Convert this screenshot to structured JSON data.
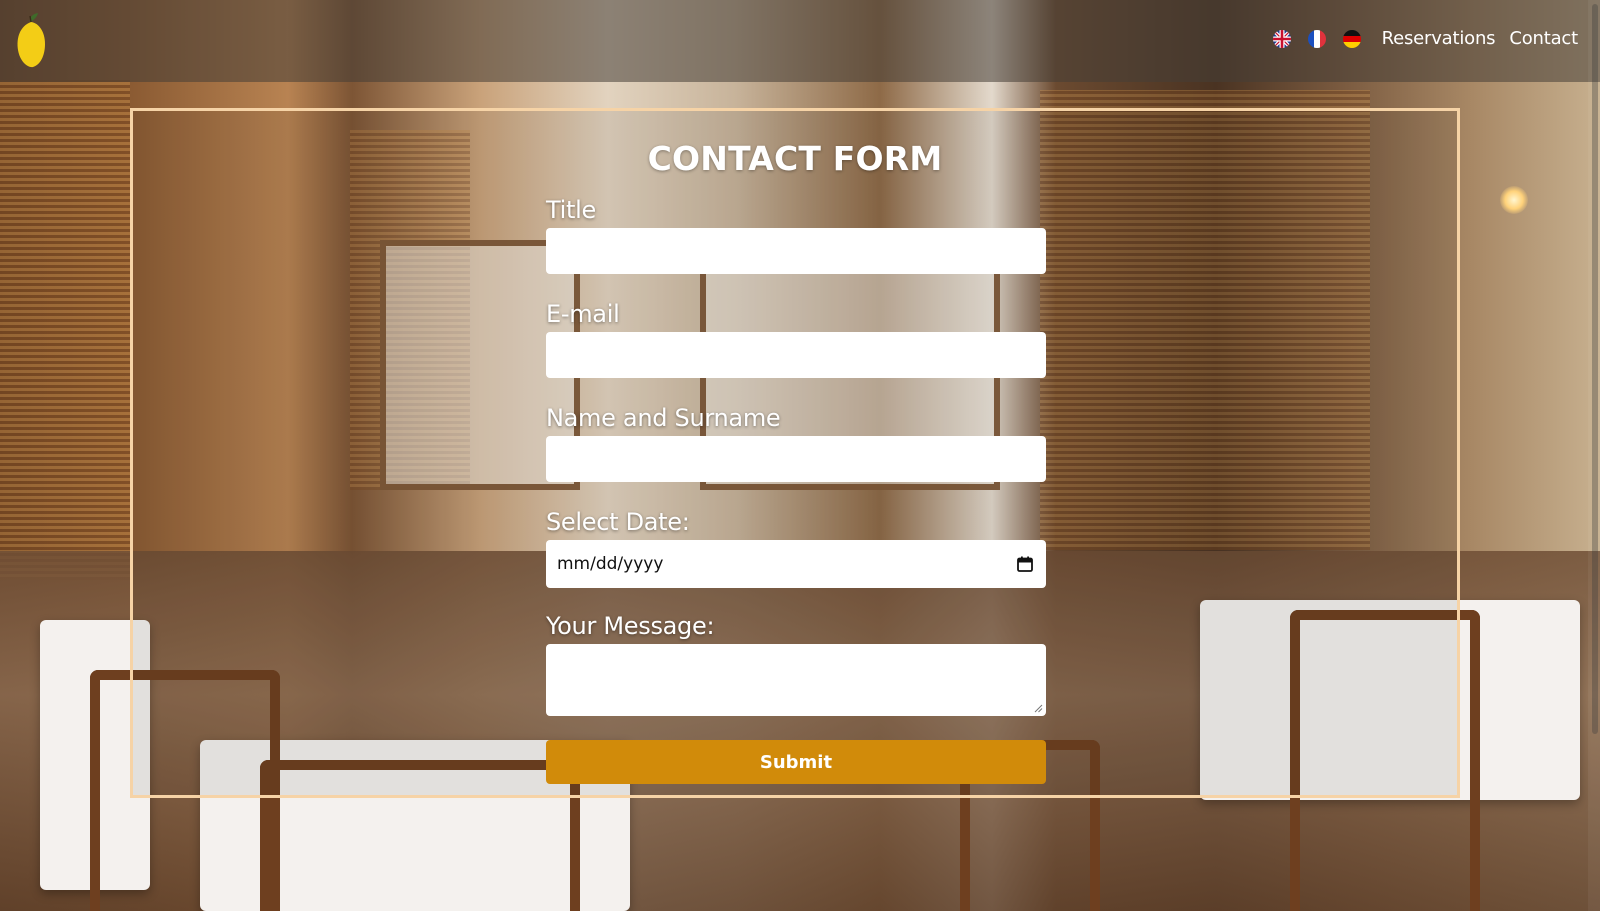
{
  "header": {
    "languages": [
      {
        "code": "en",
        "icon": "uk-flag-icon"
      },
      {
        "code": "fr",
        "icon": "france-flag-icon"
      },
      {
        "code": "de",
        "icon": "germany-flag-icon"
      }
    ],
    "nav_links": [
      "Reservations",
      "Contact"
    ],
    "logo_icon": "lemon-logo-icon"
  },
  "form": {
    "title": "CONTACT FORM",
    "fields": {
      "title_label": "Title",
      "email_label": "E-mail",
      "name_label": "Name and Surname",
      "date_label": "Select Date:",
      "date_placeholder": "mm/dd/yyyy",
      "message_label": "Your Message:"
    },
    "submit_label": "Submit"
  },
  "colors": {
    "accent": "#d18b0a",
    "frame_border": "#f6d3a6",
    "header_bg": "#463e37"
  }
}
